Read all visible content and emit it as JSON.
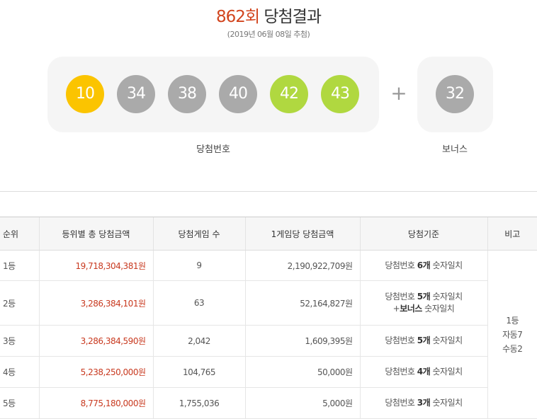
{
  "header": {
    "round": "862회",
    "title_rest": " 당첨결과",
    "date": "(2019년 06월 08일 추첨)"
  },
  "winning": {
    "label": "당첨번호",
    "numbers": [
      {
        "value": "10",
        "color": "#fbc400"
      },
      {
        "value": "34",
        "color": "#aaaaaa"
      },
      {
        "value": "38",
        "color": "#aaaaaa"
      },
      {
        "value": "40",
        "color": "#aaaaaa"
      },
      {
        "value": "42",
        "color": "#b0d840"
      },
      {
        "value": "43",
        "color": "#b0d840"
      }
    ],
    "plus": "+",
    "bonus": {
      "value": "32",
      "color": "#aaaaaa"
    },
    "bonus_label": "보너스"
  },
  "table": {
    "headers": [
      "순위",
      "등위별 총 당첨금액",
      "당첨게임 수",
      "1게임당 당첨금액",
      "당첨기준",
      "비고"
    ],
    "rows": [
      {
        "rank": "1등",
        "total": "19,718,304,381원",
        "count": "9",
        "per_game": "2,190,922,709원",
        "crit_a": "당첨번호 ",
        "crit_b": "6개",
        "crit_c": " 숫자일치",
        "crit2_a": "",
        "crit2_b": "",
        "crit2_c": ""
      },
      {
        "rank": "2등",
        "total": "3,286,384,101원",
        "count": "63",
        "per_game": "52,164,827원",
        "crit_a": "당첨번호 ",
        "crit_b": "5개",
        "crit_c": " 숫자일치",
        "crit2_a": "+",
        "crit2_b": "보너스",
        "crit2_c": " 숫자일치"
      },
      {
        "rank": "3등",
        "total": "3,286,384,590원",
        "count": "2,042",
        "per_game": "1,609,395원",
        "crit_a": "당첨번호 ",
        "crit_b": "5개",
        "crit_c": " 숫자일치",
        "crit2_a": "",
        "crit2_b": "",
        "crit2_c": ""
      },
      {
        "rank": "4등",
        "total": "5,238,250,000원",
        "count": "104,765",
        "per_game": "50,000원",
        "crit_a": "당첨번호 ",
        "crit_b": "4개",
        "crit_c": " 숫자일치",
        "crit2_a": "",
        "crit2_b": "",
        "crit2_c": ""
      },
      {
        "rank": "5등",
        "total": "8,775,180,000원",
        "count": "1,755,036",
        "per_game": "5,000원",
        "crit_a": "당첨번호 ",
        "crit_b": "3개",
        "crit_c": " 숫자일치",
        "crit2_a": "",
        "crit2_b": "",
        "crit2_c": ""
      }
    ],
    "note_lines": [
      "1등",
      "자동7",
      "수동2"
    ]
  }
}
